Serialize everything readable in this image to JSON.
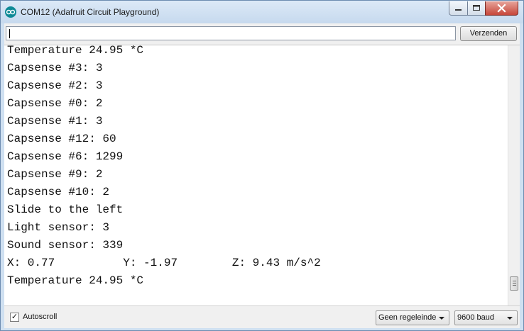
{
  "window": {
    "title": "COM12 (Adafruit Circuit Playground)",
    "icon": "arduino-icon"
  },
  "toolbar": {
    "input_value": "",
    "send_label": "Verzenden"
  },
  "output": {
    "lines": [
      "Temperature 24.95 *C",
      "Capsense #3: 3",
      "Capsense #2: 3",
      "Capsense #0: 2",
      "Capsense #1: 3",
      "Capsense #12: 60",
      "Capsense #6: 1299",
      "Capsense #9: 2",
      "Capsense #10: 2",
      "Slide to the left",
      "Light sensor: 3",
      "Sound sensor: 339",
      "X: 0.77          Y: -1.97        Z: 9.43 m/s^2",
      "Temperature 24.95 *C"
    ]
  },
  "statusbar": {
    "autoscroll_label": "Autoscroll",
    "autoscroll_checked": true,
    "line_ending": "Geen regeleinde",
    "baud": "9600 baud"
  }
}
